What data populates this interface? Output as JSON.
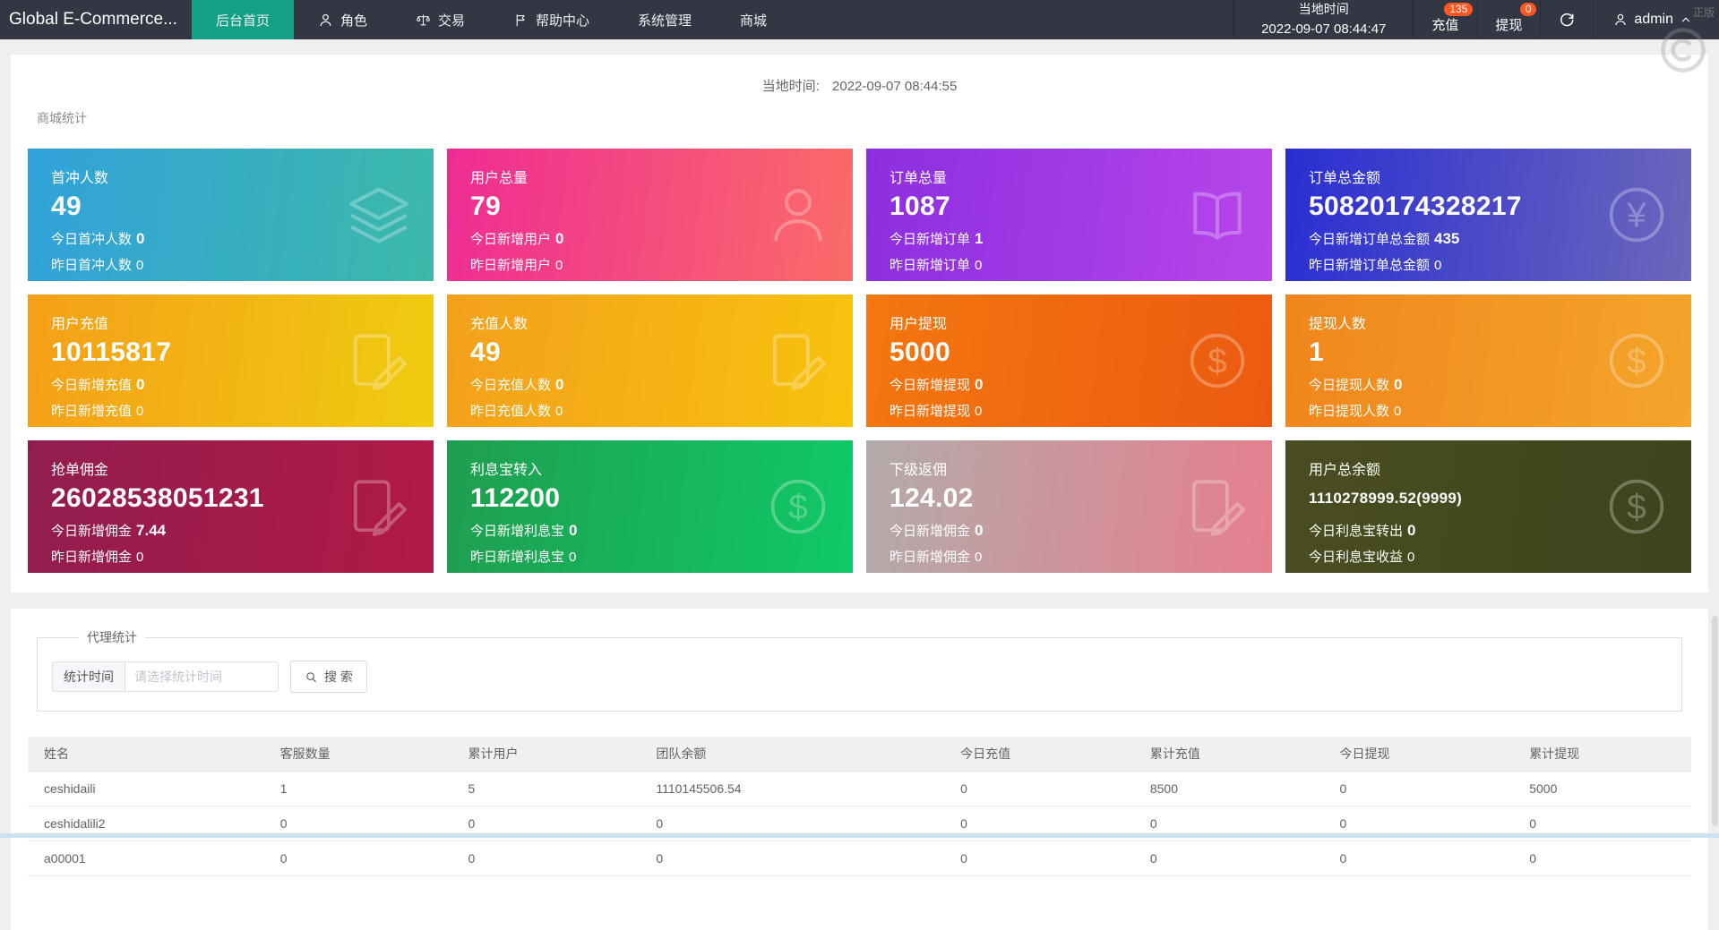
{
  "navbar": {
    "logo": "Global E-Commerce...",
    "menu": [
      {
        "label": "后台首页",
        "icon": null,
        "active": true
      },
      {
        "label": "角色",
        "icon": "person-icon",
        "active": false
      },
      {
        "label": "交易",
        "icon": "scales-icon",
        "active": false
      },
      {
        "label": "帮助中心",
        "icon": "flag-icon",
        "active": false
      },
      {
        "label": "系统管理",
        "icon": null,
        "active": false
      },
      {
        "label": "商城",
        "icon": null,
        "active": false
      }
    ],
    "local_time_label": "当地时间",
    "local_time_value": "2022-09-07 08:44:47",
    "recharge": {
      "label": "充值",
      "badge": "135"
    },
    "withdraw": {
      "label": "提现",
      "badge": "0"
    },
    "user": {
      "name": "admin"
    }
  },
  "watermark": {
    "text": "正版"
  },
  "stats_panel": {
    "time_label": "当地时间:",
    "time_value": "2022-09-07 08:44:55",
    "section_title": "商城统计",
    "cards": [
      {
        "title": "首冲人数",
        "value": "49",
        "small": false,
        "today_label": "今日首冲人数",
        "today_value": "0",
        "yesterday_label": "昨日首冲人数",
        "yesterday_value": "0",
        "icon": "layers-icon",
        "color_from": "#31a2db",
        "color_to": "#3cb9a9"
      },
      {
        "title": "用户总量",
        "value": "79",
        "small": false,
        "today_label": "今日新增用户",
        "today_value": "0",
        "yesterday_label": "昨日新增用户",
        "yesterday_value": "0",
        "icon": "user-icon",
        "color_from": "#ee2c94",
        "color_to": "#fb6c68"
      },
      {
        "title": "订单总量",
        "value": "1087",
        "small": false,
        "today_label": "今日新增订单",
        "today_value": "1",
        "yesterday_label": "昨日新增订单",
        "yesterday_value": "0",
        "icon": "book-icon",
        "color_from": "#8c2ee0",
        "color_to": "#b746e9"
      },
      {
        "title": "订单总金额",
        "value": "50820174328217",
        "small": false,
        "today_label": "今日新增订单总金额",
        "today_value": "435",
        "yesterday_label": "昨日新增订单总金额",
        "yesterday_value": "0",
        "icon": "yen-circle-icon",
        "color_from": "#2a2ed2",
        "color_to": "#6c67bb"
      },
      {
        "title": "用户充值",
        "value": "10115817",
        "small": false,
        "today_label": "今日新增充值",
        "today_value": "0",
        "yesterday_label": "昨日新增充值",
        "yesterday_value": "0",
        "icon": "edit-note-icon",
        "color_from": "#f59f18",
        "color_to": "#efcc10"
      },
      {
        "title": "充值人数",
        "value": "49",
        "small": false,
        "today_label": "今日充值人数",
        "today_value": "0",
        "yesterday_label": "昨日充值人数",
        "yesterday_value": "0",
        "icon": "edit-note-icon",
        "color_from": "#f3a01c",
        "color_to": "#f8c20e"
      },
      {
        "title": "用户提现",
        "value": "5000",
        "small": false,
        "today_label": "今日新增提现",
        "today_value": "0",
        "yesterday_label": "昨日新增提现",
        "yesterday_value": "0",
        "icon": "dollar-circle-icon",
        "color_from": "#f4770f",
        "color_to": "#eb5a11"
      },
      {
        "title": "提现人数",
        "value": "1",
        "small": false,
        "today_label": "今日提现人数",
        "today_value": "0",
        "yesterday_label": "昨日提现人数",
        "yesterday_value": "0",
        "icon": "dollar-circle-icon",
        "color_from": "#f0861c",
        "color_to": "#f4a52b"
      },
      {
        "title": "抢单佣金",
        "value": "26028538051231",
        "small": false,
        "today_label": "今日新增佣金",
        "today_value": "7.44",
        "yesterday_label": "昨日新增佣金",
        "yesterday_value": "0",
        "icon": "edit-note-icon",
        "color_from": "#911d4f",
        "color_to": "#b11a45"
      },
      {
        "title": "利息宝转入",
        "value": "112200",
        "small": false,
        "today_label": "今日新增利息宝",
        "today_value": "0",
        "yesterday_label": "昨日新增利息宝",
        "yesterday_value": "0",
        "icon": "dollar-circle-icon",
        "color_from": "#1f9e50",
        "color_to": "#10c966"
      },
      {
        "title": "下级返佣",
        "value": "124.02",
        "small": false,
        "today_label": "今日新增佣金",
        "today_value": "0",
        "yesterday_label": "昨日新增佣金",
        "yesterday_value": "0",
        "icon": "edit-note-icon",
        "color_from": "#b3abaa",
        "color_to": "#e67e8e"
      },
      {
        "title": "用户总余额",
        "value": "1110278999.52(9999)",
        "small": true,
        "today_label": "今日利息宝转出",
        "today_value": "0",
        "yesterday_label": "今日利息宝收益",
        "yesterday_value": "0",
        "icon": "dollar-circle-icon",
        "color_from": "#4a4d20",
        "color_to": "#3d441d"
      }
    ]
  },
  "agent_panel": {
    "legend": "代理统计",
    "filter_label": "统计时间",
    "filter_placeholder": "请选择统计时间",
    "search_label": "搜 索",
    "table": {
      "headers": [
        "姓名",
        "客服数量",
        "累计用户",
        "团队余额",
        "今日充值",
        "累计充值",
        "今日提现",
        "累计提现"
      ],
      "col_widths": [
        "14.2%",
        "11.3%",
        "11.3%",
        "18.3%",
        "11.4%",
        "11.4%",
        "11.4%",
        "10.7%"
      ],
      "rows": [
        [
          "ceshidaili",
          "1",
          "5",
          "1110145506.54",
          "0",
          "8500",
          "0",
          "5000"
        ],
        [
          "ceshidalili2",
          "0",
          "0",
          "0",
          "0",
          "0",
          "0",
          "0"
        ],
        [
          "a00001",
          "0",
          "0",
          "0",
          "0",
          "0",
          "0",
          "0"
        ]
      ]
    }
  },
  "colors": {
    "navbar_bg": "#333744",
    "active_tab": "#14a086",
    "badge": "#ff5722"
  }
}
